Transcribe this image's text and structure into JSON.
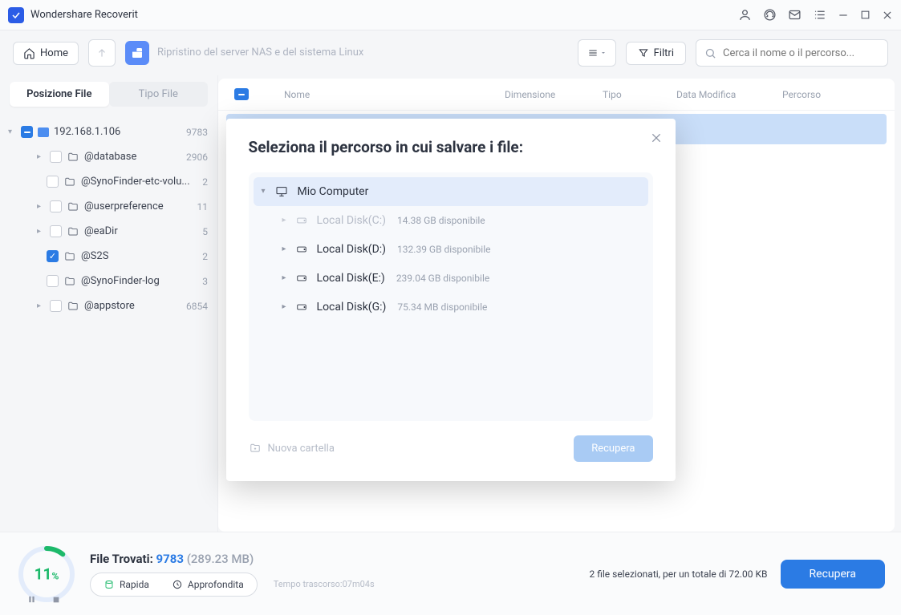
{
  "app_title": "Wondershare Recoverit",
  "toolbar": {
    "home_label": "Home",
    "breadcrumb": "Ripristino del server NAS e del sistema Linux",
    "filter_label": "Filtri",
    "search_placeholder": "Cerca il nome o il percorso..."
  },
  "tabs": {
    "location": "Posizione File",
    "type": "Tipo File"
  },
  "tree": {
    "root": {
      "ip": "192.168.1.106",
      "count": "9783"
    },
    "items": [
      {
        "name": "@database",
        "count": "2906",
        "expand": true
      },
      {
        "name": "@SynoFinder-etc-volu...",
        "count": "2",
        "expand": false
      },
      {
        "name": "@userpreference",
        "count": "11",
        "expand": true
      },
      {
        "name": "@eaDir",
        "count": "5",
        "expand": true
      },
      {
        "name": "@S2S",
        "count": "2",
        "expand": false,
        "checked": true
      },
      {
        "name": "@SynoFinder-log",
        "count": "3",
        "expand": false
      },
      {
        "name": "@appstore",
        "count": "6854",
        "expand": true
      }
    ]
  },
  "columns": {
    "name": "Nome",
    "size": "Dimensione",
    "type": "Tipo",
    "date": "Data Modifica",
    "path": "Percorso"
  },
  "modal": {
    "title": "Seleziona il percorso in cui salvare i file:",
    "root": "Mio Computer",
    "drives": [
      {
        "name": "Local Disk(C:)",
        "avail": "14.38 GB disponibile",
        "dimmed": true
      },
      {
        "name": "Local Disk(D:)",
        "avail": "132.39 GB disponibile"
      },
      {
        "name": "Local Disk(E:)",
        "avail": "239.04 GB disponibile"
      },
      {
        "name": "Local Disk(G:)",
        "avail": "75.34 MB disponibile"
      }
    ],
    "new_folder": "Nuova cartella",
    "recover": "Recupera"
  },
  "footer": {
    "percent": "11",
    "found_label": "File Trovati: ",
    "found_count": "9783 ",
    "found_size": "(289.23 MB)",
    "mode_fast": "Rapida",
    "mode_deep": "Approfondita",
    "elapsed": "Tempo trascorso:07m04s",
    "status": "2 file selezionati, per un totale di 72.00 KB",
    "recover_btn": "Recupera"
  }
}
